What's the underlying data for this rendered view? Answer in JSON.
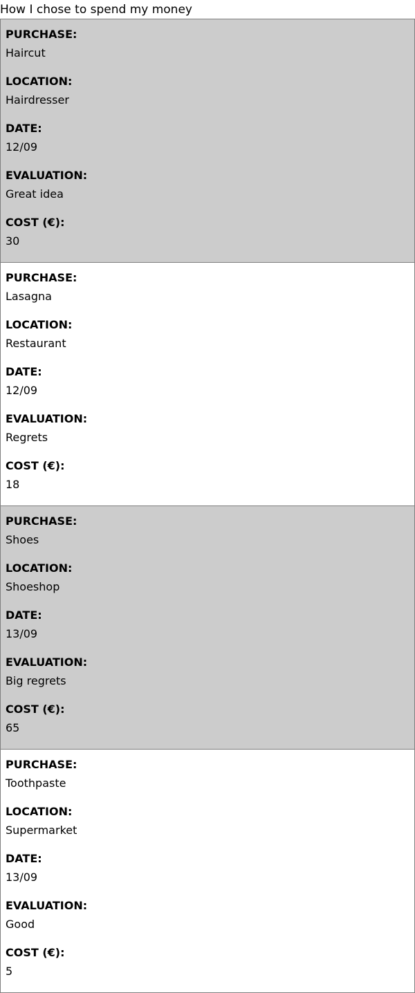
{
  "caption": "How I chose to spend my money",
  "labels": {
    "purchase": "PURCHASE:",
    "location": "LOCATION:",
    "date": "DATE:",
    "evaluation": "EVALUATION:",
    "cost": "COST (€):"
  },
  "colors": {
    "shaded_row": "#cccccc",
    "plain_row": "#ffffff",
    "border": "#7f7f7f"
  },
  "records": [
    {
      "purchase": "Haircut",
      "location": "Hairdresser",
      "date": "12/09",
      "evaluation": "Great idea",
      "cost": "30"
    },
    {
      "purchase": "Lasagna",
      "location": "Restaurant",
      "date": "12/09",
      "evaluation": "Regrets",
      "cost": "18"
    },
    {
      "purchase": "Shoes",
      "location": "Shoeshop",
      "date": "13/09",
      "evaluation": "Big regrets",
      "cost": "65"
    },
    {
      "purchase": "Toothpaste",
      "location": "Supermarket",
      "date": "13/09",
      "evaluation": "Good",
      "cost": "5"
    }
  ]
}
